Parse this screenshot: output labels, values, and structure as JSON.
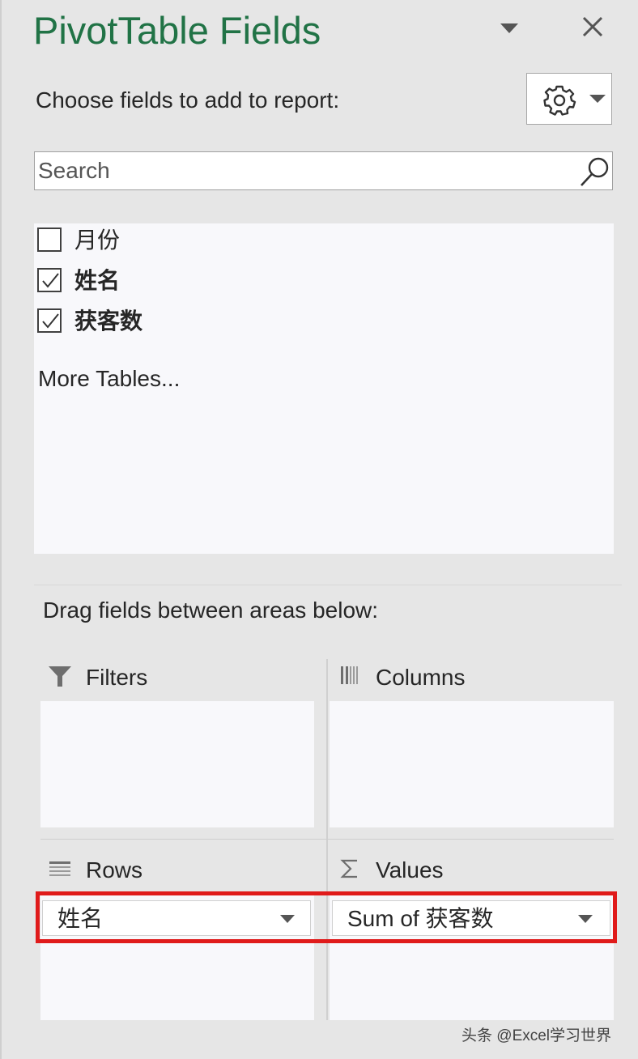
{
  "panel": {
    "title": "PivotTable Fields",
    "choose_label": "Choose fields to add to report:",
    "search_placeholder": "Search"
  },
  "fields": [
    {
      "label": "月份",
      "checked": false
    },
    {
      "label": "姓名",
      "checked": true
    },
    {
      "label": "获客数",
      "checked": true
    }
  ],
  "more_tables": "More Tables...",
  "drag_label": "Drag fields between areas below:",
  "areas": {
    "filters": {
      "label": "Filters",
      "icon": "filter-icon"
    },
    "columns": {
      "label": "Columns",
      "icon": "columns-icon"
    },
    "rows": {
      "label": "Rows",
      "icon": "rows-icon",
      "item": "姓名"
    },
    "values": {
      "label": "Values",
      "icon": "sigma-icon",
      "item": "Sum of 获客数"
    }
  },
  "colors": {
    "title_green": "#217346",
    "highlight_red": "#e01b1b",
    "panel_bg": "#e6e6e6",
    "list_bg": "#f8f8fb"
  },
  "watermark": "头条 @Excel学习世界"
}
